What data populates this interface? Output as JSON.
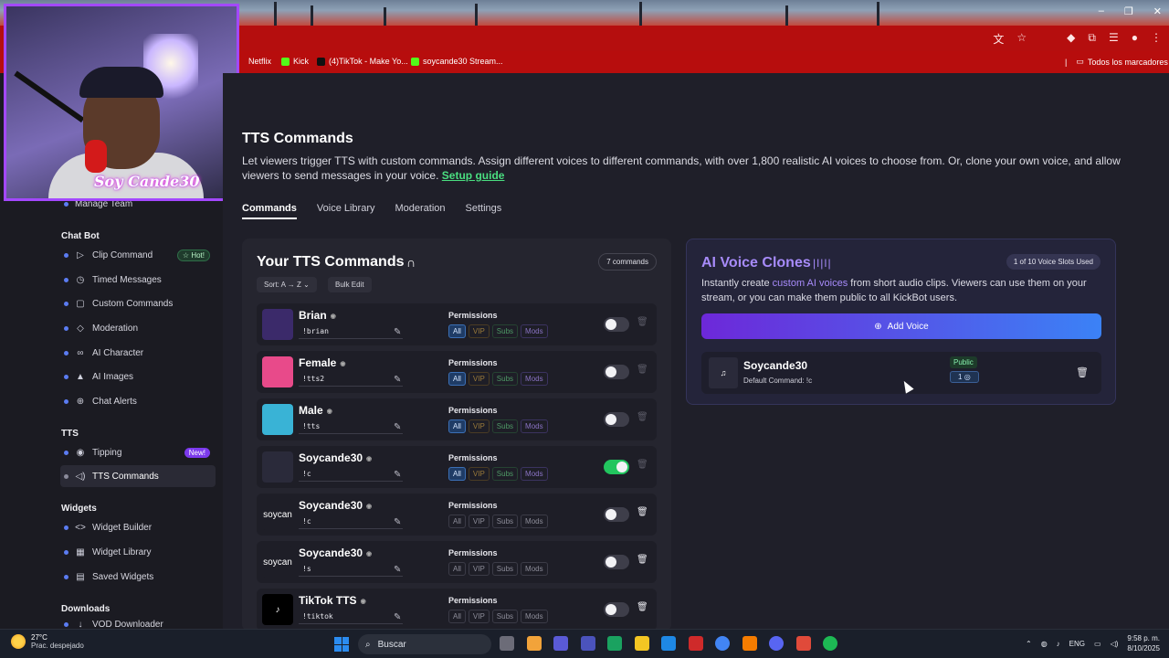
{
  "window": {
    "controls": [
      "–",
      "❐",
      "✕"
    ]
  },
  "bookmarks": {
    "items": [
      {
        "label": "Netflix",
        "color": "#b70d0d"
      },
      {
        "label": "Kick",
        "color": "#53fc18"
      },
      {
        "label": "(4)TikTok - Make Yo...",
        "color": "#111111"
      },
      {
        "label": "soycande30 Stream...",
        "color": "#53fc18"
      }
    ],
    "all": "Todos los marcadores"
  },
  "sidebar": {
    "manage_team": "Manage Team",
    "sections": {
      "chatbot": "Chat Bot",
      "tts": "TTS",
      "widgets": "Widgets",
      "downloads": "Downloads"
    },
    "chatbot_items": [
      {
        "label": "Clip Command",
        "icon": "play-icon",
        "badge": "Hot!"
      },
      {
        "label": "Timed Messages",
        "icon": "clock-icon"
      },
      {
        "label": "Custom Commands",
        "icon": "terminal-icon"
      },
      {
        "label": "Moderation",
        "icon": "shield-icon"
      },
      {
        "label": "AI Character",
        "icon": "link-icon"
      },
      {
        "label": "AI Images",
        "icon": "image-icon"
      },
      {
        "label": "Chat Alerts",
        "icon": "globe-icon"
      }
    ],
    "tts_items": [
      {
        "label": "Tipping",
        "icon": "coin-icon",
        "badge": "New!"
      },
      {
        "label": "TTS Commands",
        "icon": "speaker-icon"
      }
    ],
    "widget_items": [
      {
        "label": "Widget Builder",
        "icon": "code-icon"
      },
      {
        "label": "Widget Library",
        "icon": "grid-icon"
      },
      {
        "label": "Saved Widgets",
        "icon": "save-icon"
      }
    ],
    "downloads_item": "VOD Downloader"
  },
  "webcam": {
    "logo_text": "Soy Cande30"
  },
  "main": {
    "title": "TTS Commands",
    "description": "Let viewers trigger TTS with custom commands. Assign different voices to different commands, with over 1,800 realistic AI voices to choose from. Or, clone your own voice, and allow viewers to send messages in your voice.",
    "setup_link": "Setup guide",
    "tabs": [
      "Commands",
      "Voice Library",
      "Moderation",
      "Settings"
    ]
  },
  "commands": {
    "title": "Your TTS Commands",
    "count": "7 commands",
    "sort": "Sort: A → Z",
    "bulk_edit": "Bulk Edit",
    "permissions_label": "Permissions",
    "perm_labels": [
      "All",
      "VIP",
      "Subs",
      "Mods"
    ],
    "rows": [
      {
        "name": "Brian",
        "trigger": "!brian",
        "avatar_color": "#3b2a6a",
        "avatar_text": "",
        "enabled": false
      },
      {
        "name": "Female",
        "trigger": "!tts2",
        "avatar_color": "#e84a8a",
        "avatar_text": "",
        "enabled": false
      },
      {
        "name": "Male",
        "trigger": "!tts",
        "avatar_color": "#39b3d6",
        "avatar_text": "",
        "enabled": false
      },
      {
        "name": "Soycande30",
        "trigger": "!c",
        "avatar_color": "#2a2a3a",
        "avatar_text": "",
        "enabled": true
      },
      {
        "name": "Soycande30",
        "trigger": "!c",
        "avatar_color": "#1e1e27",
        "avatar_text": "soycan",
        "enabled": false
      },
      {
        "name": "Soycande30",
        "trigger": "!s",
        "avatar_color": "#1e1e27",
        "avatar_text": "soycan",
        "enabled": false
      },
      {
        "name": "TikTok TTS",
        "trigger": "!tiktok",
        "avatar_color": "#000000",
        "avatar_text": "♪",
        "enabled": false
      }
    ]
  },
  "voice_clones": {
    "title": "AI Voice Clones",
    "slots": "1 of 10 Voice Slots Used",
    "desc_pre": "Instantly create ",
    "desc_link": "custom AI voices",
    "desc_post": " from short audio clips. Viewers can use them on your stream, or you can make them public to all KickBot users.",
    "add_voice": "Add Voice",
    "voice": {
      "name": "Soycande30",
      "default_command": "Default Command: !c",
      "visibility": "Public",
      "uses": "1"
    }
  },
  "taskbar": {
    "temp": "27°C",
    "weather": "Prac. despejado",
    "search": "Buscar",
    "lang": "ENG",
    "time": "9:58 p. m.",
    "date": "8/10/2025",
    "apps": [
      "#6c6c78",
      "#f2a33a",
      "#5a5ad6",
      "#4b53bc",
      "#1aa260",
      "#f3c623",
      "#1e88e5",
      "#cf2a2a",
      "#4285f4",
      "#f57c00",
      "#5865f2",
      "#e04a3a",
      "#1db954"
    ]
  }
}
